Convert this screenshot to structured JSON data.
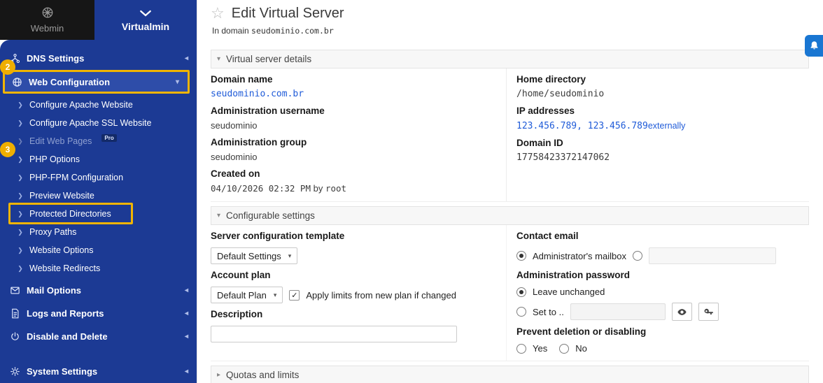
{
  "app": {
    "tabs": {
      "webmin": "Webmin",
      "virtualmin": "Virtualmin"
    }
  },
  "sidebar": {
    "badges": {
      "web_configuration": "2",
      "php_options": "3"
    },
    "categories": {
      "dns": "DNS Settings",
      "web": "Web Configuration",
      "mail": "Mail Options",
      "logs": "Logs and Reports",
      "disable": "Disable and Delete",
      "system": "System Settings"
    },
    "web_subitems": [
      "Configure Apache Website",
      "Configure Apache SSL Website",
      "Edit Web Pages",
      "PHP Options",
      "PHP-FPM Configuration",
      "Preview Website",
      "Protected Directories",
      "Proxy Paths",
      "Website Options",
      "Website Redirects"
    ],
    "pro_badge": "Pro"
  },
  "header": {
    "title": "Edit Virtual Server",
    "domain_prefix": "In domain",
    "domain": "seudominio.com.br"
  },
  "details": {
    "title": "Virtual server details",
    "domain_name_label": "Domain name",
    "domain_name": "seudominio.com.br",
    "admin_username_label": "Administration username",
    "admin_username": "seudominio",
    "admin_group_label": "Administration group",
    "admin_group": "seudominio",
    "created_label": "Created on",
    "created_datetime": "04/10/2026 02:32 PM",
    "created_by": "by",
    "created_user": "root",
    "home_dir_label": "Home directory",
    "home_dir": "/home/seudominio",
    "ip_label": "IP addresses",
    "ip_value": "123.456.789, 123.456.789",
    "ip_suffix": "externally",
    "domain_id_label": "Domain ID",
    "domain_id": "17758423372147062"
  },
  "config": {
    "title": "Configurable settings",
    "template_label": "Server configuration template",
    "template_value": "Default Settings",
    "plan_label": "Account plan",
    "plan_value": "Default Plan",
    "plan_checkbox": "Apply limits from new plan if changed",
    "description_label": "Description",
    "contact_label": "Contact email",
    "contact_option1": "Administrator's mailbox",
    "password_label": "Administration password",
    "password_option1": "Leave unchanged",
    "password_option2": "Set to ..",
    "prevent_label": "Prevent deletion or disabling",
    "prevent_yes": "Yes",
    "prevent_no": "No"
  },
  "quotas": {
    "title": "Quotas and limits"
  },
  "colors": {
    "sidebar_blue": "#1c3a94",
    "active_row_blue": "#2e4da9",
    "highlight_gold": "#f0b400",
    "badge_yellow": "#efae00",
    "link_blue": "#1f5bd8",
    "bell_blue": "#1976d2"
  }
}
